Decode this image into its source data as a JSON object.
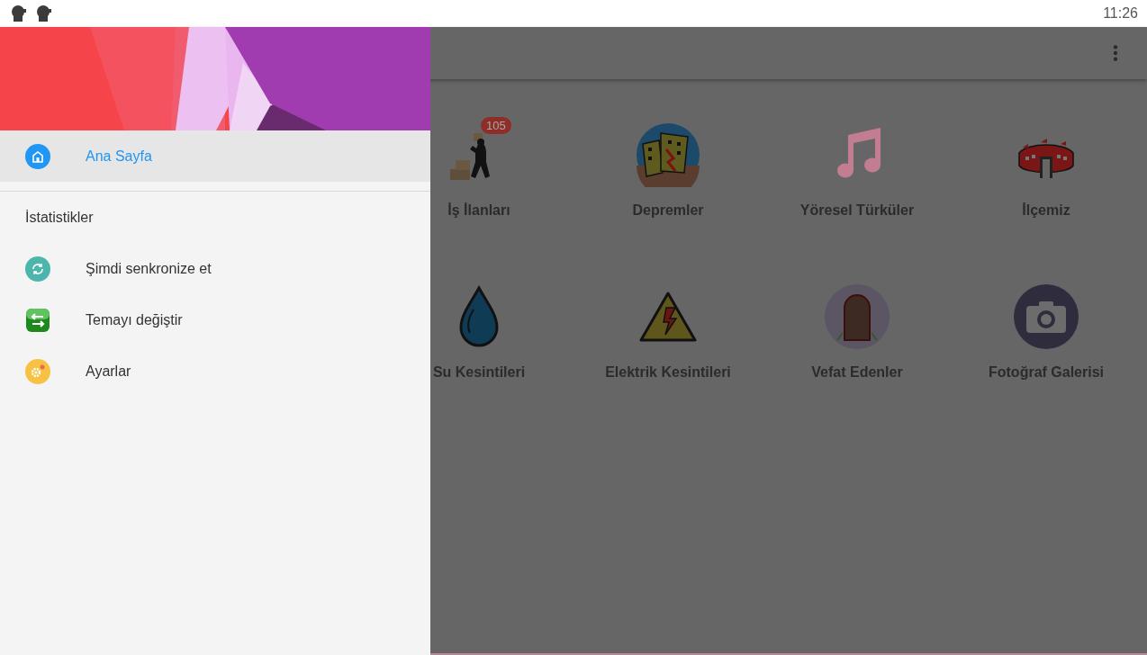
{
  "status_bar": {
    "time": "11:26"
  },
  "drawer": {
    "sections": [
      {
        "items": [
          {
            "label": "Ana Sayfa",
            "selected": true
          }
        ]
      },
      {
        "title": "İstatistikler",
        "items": [
          {
            "label": "Şimdi senkronize et",
            "selected": false
          },
          {
            "label": "Temayı değiştir",
            "selected": false
          },
          {
            "label": "Ayarlar",
            "selected": false
          }
        ]
      }
    ]
  },
  "grid": [
    {
      "label": "İş İlanları",
      "badge": "105"
    },
    {
      "label": "Depremler"
    },
    {
      "label": "Yöresel Türküler"
    },
    {
      "label": "İlçemiz"
    },
    {
      "label": "Su Kesintileri"
    },
    {
      "label": "Elektrik Kesintileri"
    },
    {
      "label": "Vefat Edenler"
    },
    {
      "label": "Fotoğraf Galerisi"
    }
  ]
}
